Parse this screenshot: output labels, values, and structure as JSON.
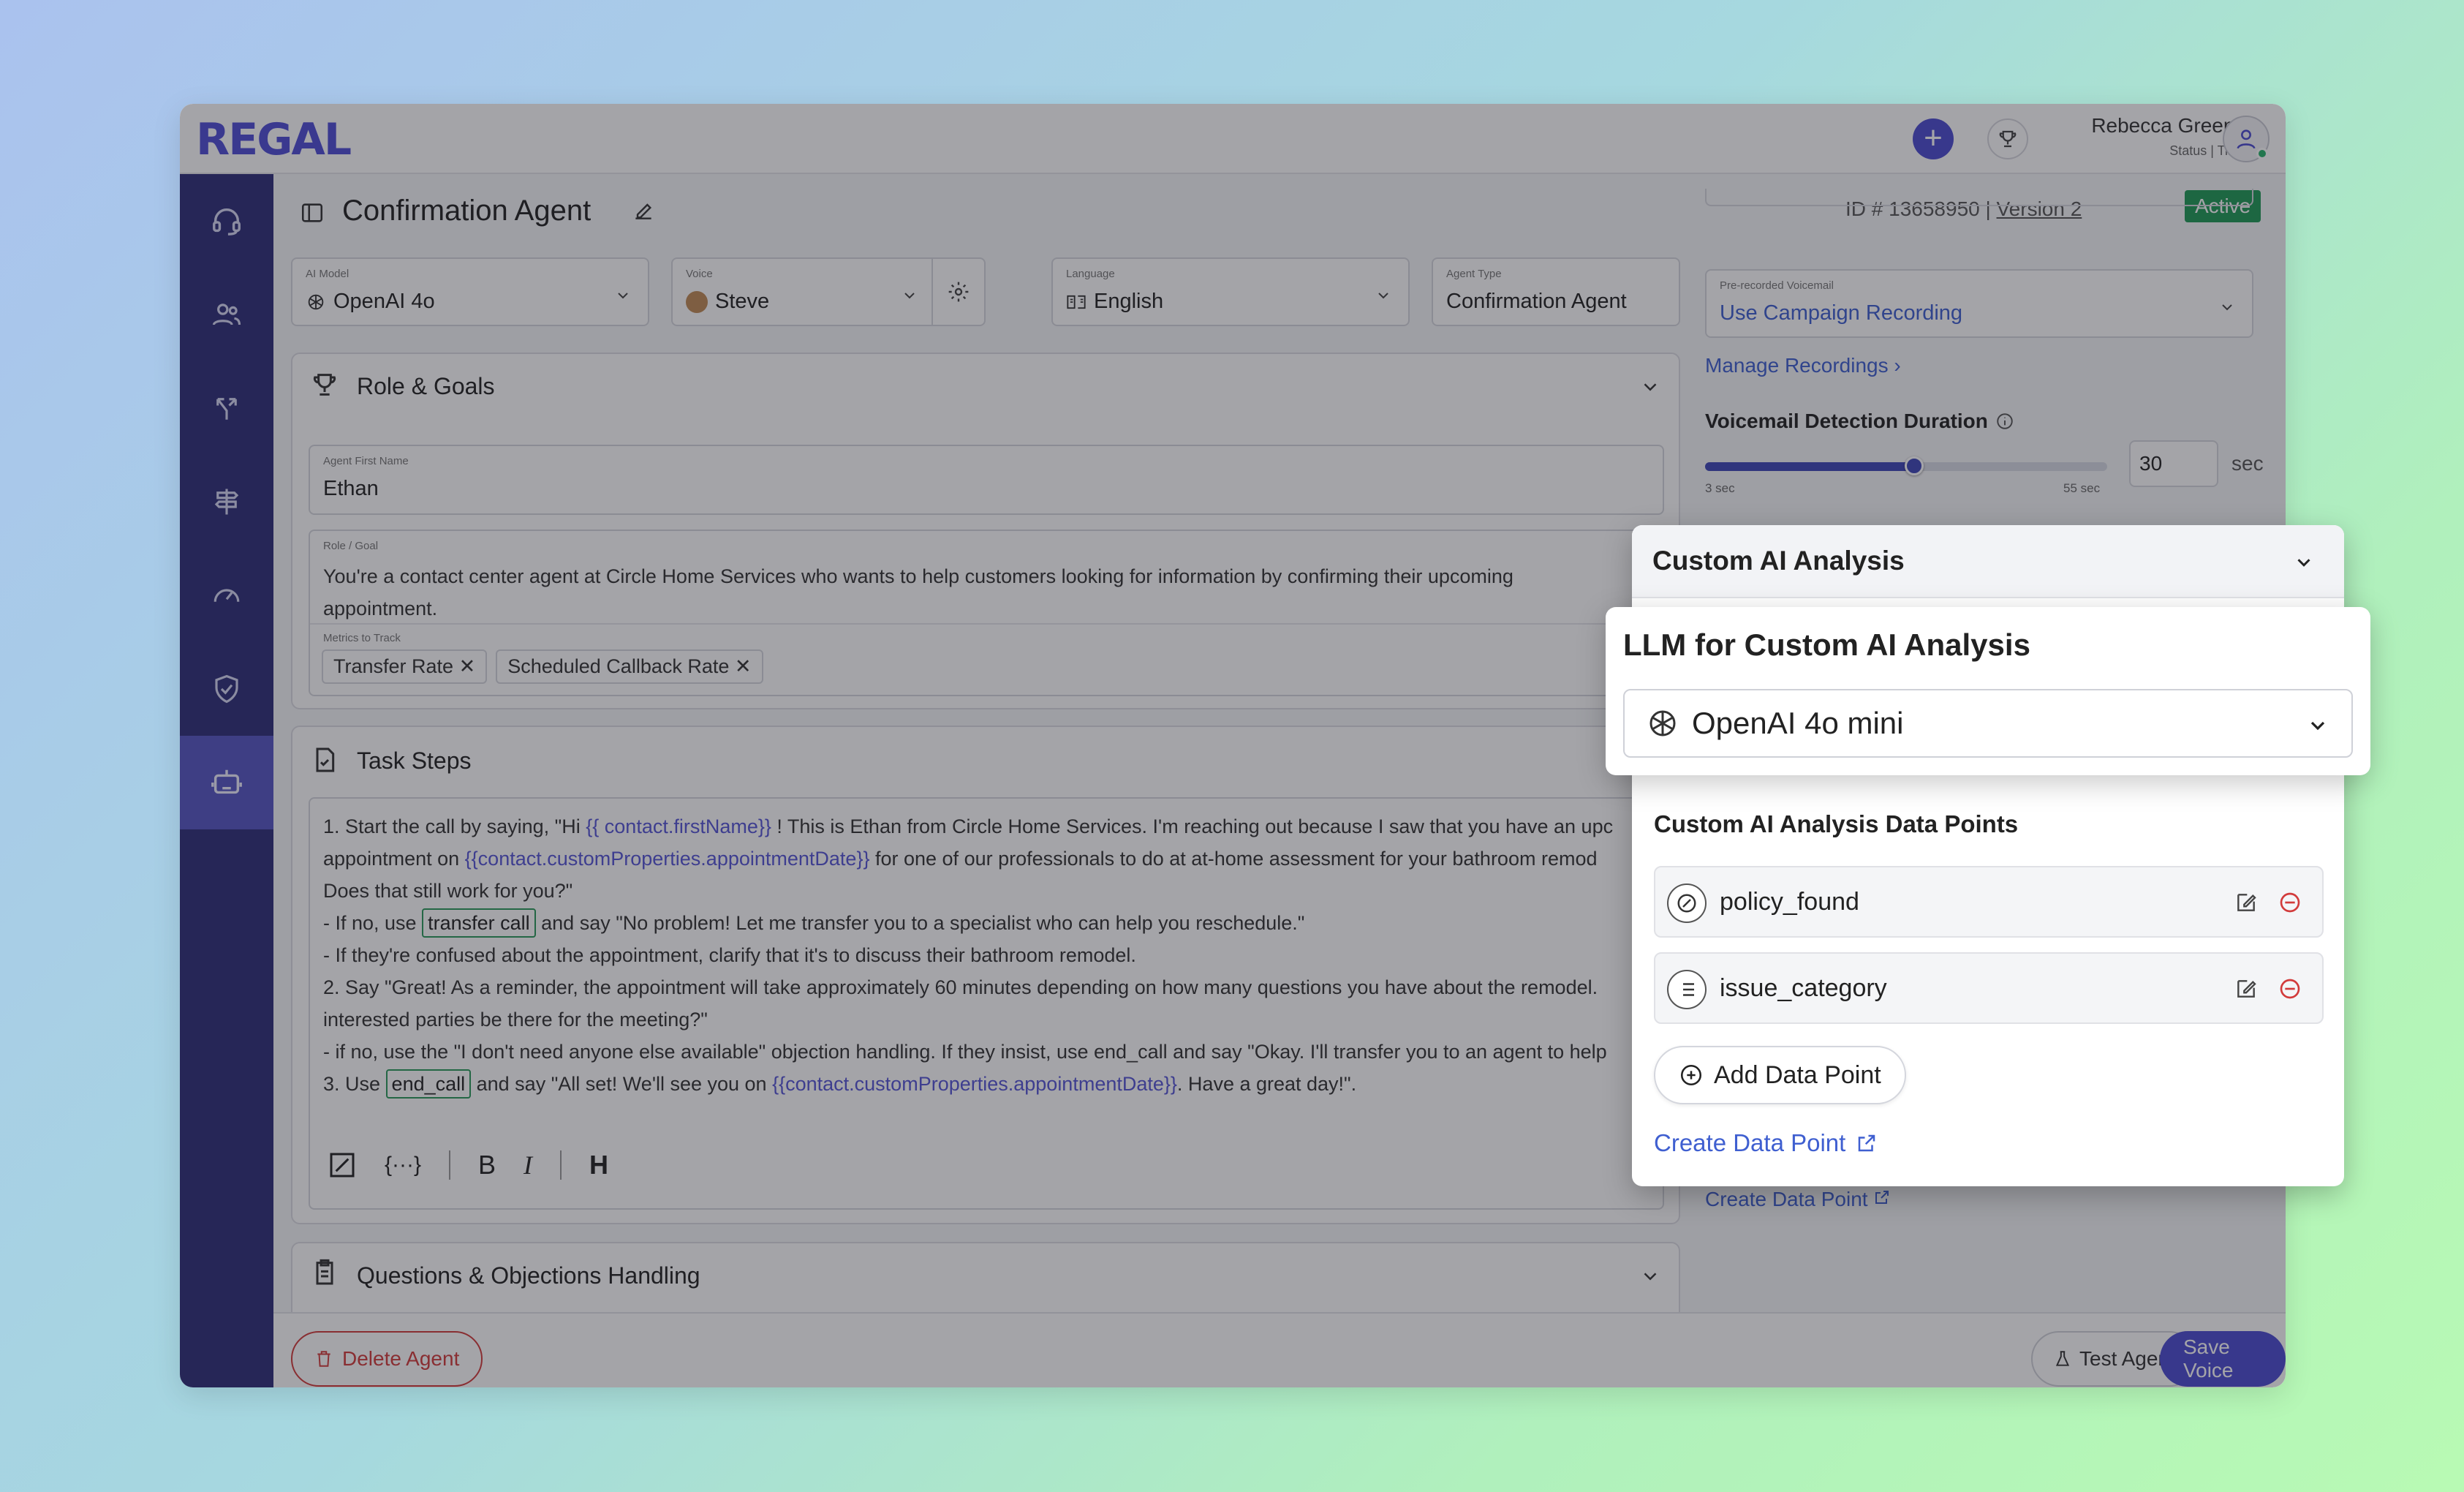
{
  "app": {
    "logo": "REGAL"
  },
  "topbar": {
    "user_name": "Rebecca Greene",
    "user_status": "Status | Time"
  },
  "header": {
    "title": "Confirmation Agent",
    "id_text": "ID # 13658950 |",
    "version": "Version 2",
    "status": "Active"
  },
  "settings": {
    "ai_model": {
      "label": "AI Model",
      "value": "OpenAI 4o"
    },
    "voice": {
      "label": "Voice",
      "value": "Steve"
    },
    "language": {
      "label": "Language",
      "value": "English"
    },
    "agent_type": {
      "label": "Agent Type",
      "value": "Confirmation Agent"
    }
  },
  "role_goals": {
    "title": "Role & Goals",
    "first_name_label": "Agent First Name",
    "first_name": "Ethan",
    "goal_label": "Role / Goal",
    "goal_line1": "You're a contact center agent at Circle Home Services who wants to help customers looking for information by confirming their upcoming",
    "goal_line2": "appointment.",
    "metrics_label": "Metrics to Track",
    "metrics": [
      "Transfer Rate",
      "Scheduled Callback Rate"
    ]
  },
  "task_steps": {
    "title": "Task Steps",
    "l1a": "1.  Start the call by saying, \"Hi ",
    "l1var": "{{ contact.firstName}}",
    "l1b": " ! This is Ethan from Circle Home Services. I'm reaching out because I saw that you have an upc",
    "l2a": "appointment on ",
    "l2var": "{{contact.customProperties.appointmentDate}}",
    "l2b": " for one of our professionals to do at at-home assessment for your bathroom remod",
    "l3": "Does that still work for you?\"",
    "l4a": "- If no, use ",
    "l4tag": "transfer call",
    "l4b": " and say \"No problem! Let me transfer you to a specialist who can help you reschedule.\"",
    "l5": "- If they're confused about the appointment, clarify that it's to discuss their bathroom remodel.",
    "l6": "2. Say \"Great! As a reminder, the appointment will take approximately 60 minutes depending on how many questions you have about the remodel.",
    "l7": "interested parties be there for the meeting?\"",
    "l8": "- if no, use the \"I don't need anyone else available\" objection handling. If they insist, use end_call and say \"Okay. I'll transfer you to an agent to help",
    "l9a": "3. Use ",
    "l9tag": "end_call",
    "l9b": " and say \"All set! We'll see you on ",
    "l9var": "{{contact.customProperties.appointmentDate}}",
    "l9c": ". Have a great day!\"."
  },
  "questions": {
    "title": "Questions & Objections Handling"
  },
  "right": {
    "voicemail_label": "Pre-recorded Voicemail",
    "voicemail_value": "Use Campaign Recording",
    "manage_recordings": "Manage Recordings",
    "vm_duration_title": "Voicemail Detection Duration",
    "slider_min": "3 sec",
    "slider_max": "55 sec",
    "slider_value": "30",
    "slider_unit": "sec",
    "slider_fraction": 0.52,
    "create_data_point": "Create Data Point"
  },
  "popup": {
    "title": "Custom AI Analysis",
    "llm_title": "LLM for Custom AI Analysis",
    "llm_value": "OpenAI 4o mini",
    "data_points_title": "Custom AI Analysis Data Points",
    "data_points": [
      {
        "name": "policy_found",
        "icon": "boolean-icon"
      },
      {
        "name": "issue_category",
        "icon": "list-icon"
      }
    ],
    "add_label": "Add Data Point",
    "create_label": "Create Data Point"
  },
  "footer": {
    "delete": "Delete Agent",
    "test": "Test Agent",
    "save": "Save Voice"
  },
  "colors": {
    "brand": "#4b4bd0",
    "sidebar": "#2e2e78",
    "active": "#1e9a55",
    "danger": "#d23b3b",
    "link": "#3f5fd0"
  }
}
